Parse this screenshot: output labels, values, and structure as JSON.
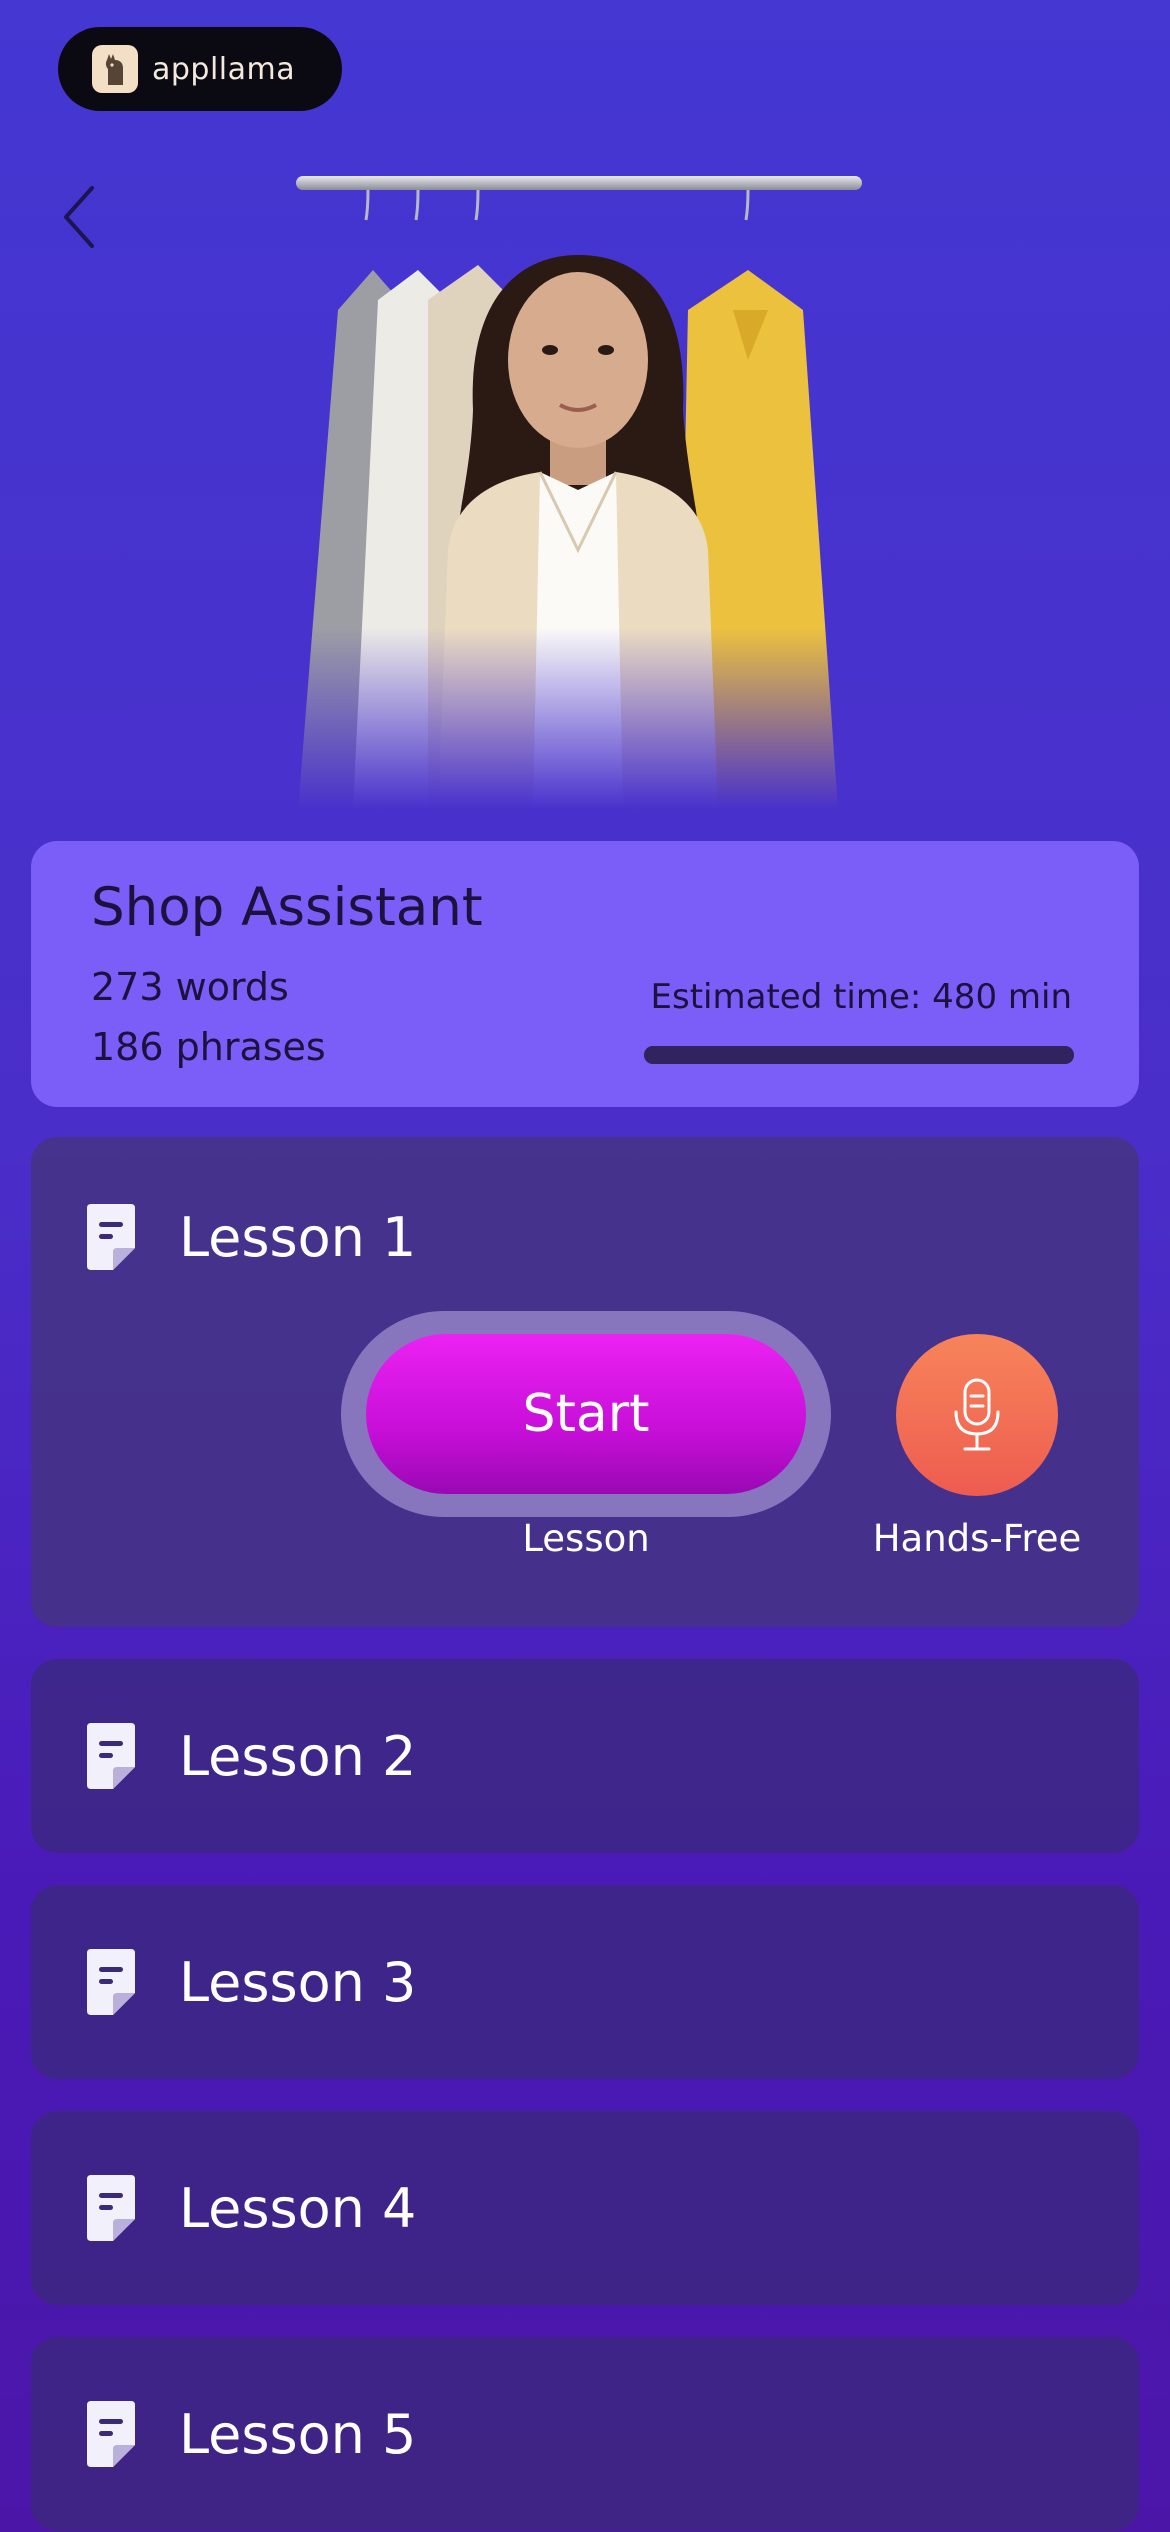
{
  "brand": {
    "name": "appllama",
    "logo_icon": "llama-icon"
  },
  "nav": {
    "back_icon": "chevron-left-icon"
  },
  "scenario": {
    "title": "Shop Assistant",
    "words": "273 words",
    "phrases": "186 phrases",
    "estimated_time": "Estimated time: 480 min",
    "progress_fraction": 1.0
  },
  "lessons": [
    {
      "label": "Lesson 1",
      "icon": "document-icon",
      "start_label": "Start",
      "start_caption": "Lesson",
      "handsfree_caption": "Hands-Free",
      "handsfree_icon": "microphone-icon"
    },
    {
      "label": "Lesson 2",
      "icon": "document-icon"
    },
    {
      "label": "Lesson 3",
      "icon": "document-icon"
    },
    {
      "label": "Lesson 4",
      "icon": "document-icon"
    },
    {
      "label": "Lesson 5",
      "icon": "document-icon"
    }
  ],
  "colors": {
    "background_top": "#4437d2",
    "background_bottom": "#4b16a8",
    "info_card": "#7b5df8",
    "start_button": "#d214e4",
    "handsfree_button": "#f2704f"
  }
}
